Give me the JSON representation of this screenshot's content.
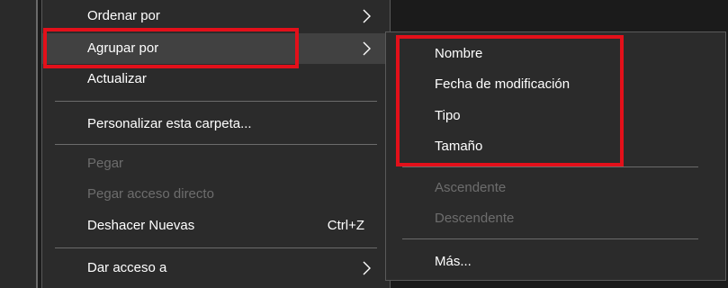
{
  "main_menu": {
    "ordenar_por": "Ordenar por",
    "agrupar_por": "Agrupar por",
    "actualizar": "Actualizar",
    "personalizar": "Personalizar esta carpeta...",
    "pegar": "Pegar",
    "pegar_acceso_directo": "Pegar acceso directo",
    "deshacer": "Deshacer Nuevas",
    "deshacer_shortcut": "Ctrl+Z",
    "dar_acceso": "Dar acceso a"
  },
  "sub_menu": {
    "nombre": "Nombre",
    "fecha": "Fecha de modificación",
    "tipo": "Tipo",
    "tamano": "Tamaño",
    "ascendente": "Ascendente",
    "descendente": "Descendente",
    "mas": "Más..."
  },
  "colors": {
    "menu_bg": "#2b2b2b",
    "highlight": "#414141",
    "disabled_text": "#6d6d6d",
    "annotation_red": "#e3101a"
  },
  "icons": {
    "submenu_arrow": "chevron-right-icon"
  }
}
